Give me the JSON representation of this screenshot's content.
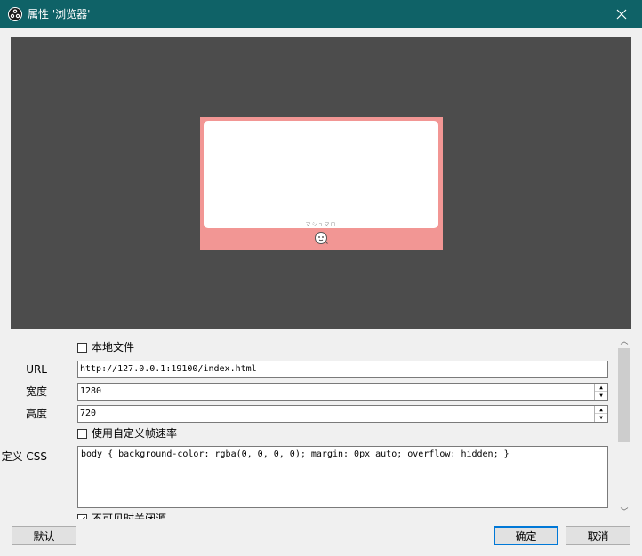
{
  "window": {
    "title": "属性 '浏览器'",
    "close_icon": "close-icon"
  },
  "preview": {
    "canvas_color": "#4c4c4c",
    "source_bg_color": "#f29694",
    "brand_text": "マシュマロ"
  },
  "properties": {
    "local_file": {
      "label": "本地文件",
      "checked": false
    },
    "url": {
      "label": "URL",
      "value": "http://127.0.0.1:19100/index.html"
    },
    "width": {
      "label": "宽度",
      "value": "1280"
    },
    "height": {
      "label": "高度",
      "value": "720"
    },
    "custom_fps": {
      "label": "使用自定义帧速率",
      "checked": false
    },
    "custom_css": {
      "label": "自定义 CSS",
      "value": "body { background-color: rgba(0, 0, 0, 0); margin: 0px auto; overflow: hidden; }"
    },
    "shutdown_when_hidden": {
      "label": "不可见时关闭源",
      "checked": true
    }
  },
  "buttons": {
    "defaults": "默认",
    "ok": "确定",
    "cancel": "取消"
  },
  "colors": {
    "titlebar": "#0f6267",
    "accent": "#0078d7"
  }
}
